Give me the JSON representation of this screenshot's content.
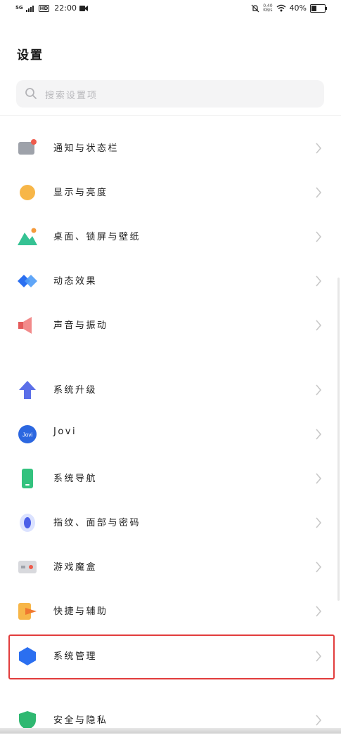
{
  "status_bar": {
    "network": "5G",
    "hd": "HD",
    "time": "22:00",
    "speed_top": "0.40",
    "speed_bottom": "KB/s",
    "battery": "40%",
    "battery_level": 0.4
  },
  "header": {
    "title": "设置"
  },
  "search": {
    "placeholder": "搜索设置项"
  },
  "items": [
    {
      "label": "通知与状态栏",
      "icon": "notification-icon"
    },
    {
      "label": "显示与亮度",
      "icon": "display-icon"
    },
    {
      "label": "桌面、锁屏与壁纸",
      "icon": "wallpaper-icon"
    },
    {
      "label": "动态效果",
      "icon": "animation-icon"
    },
    {
      "label": "声音与振动",
      "icon": "sound-icon"
    },
    {
      "label": "系统升级",
      "icon": "update-icon"
    },
    {
      "label": "Jovi",
      "icon": "jovi-icon",
      "icon_text": "Jovi"
    },
    {
      "label": "系统导航",
      "icon": "navigation-icon"
    },
    {
      "label": "指纹、面部与密码",
      "icon": "fingerprint-icon"
    },
    {
      "label": "游戏魔盒",
      "icon": "game-box-icon"
    },
    {
      "label": "快捷与辅助",
      "icon": "shortcut-icon"
    },
    {
      "label": "系统管理",
      "icon": "system-management-icon"
    },
    {
      "label": "安全与隐私",
      "icon": "security-icon"
    }
  ]
}
